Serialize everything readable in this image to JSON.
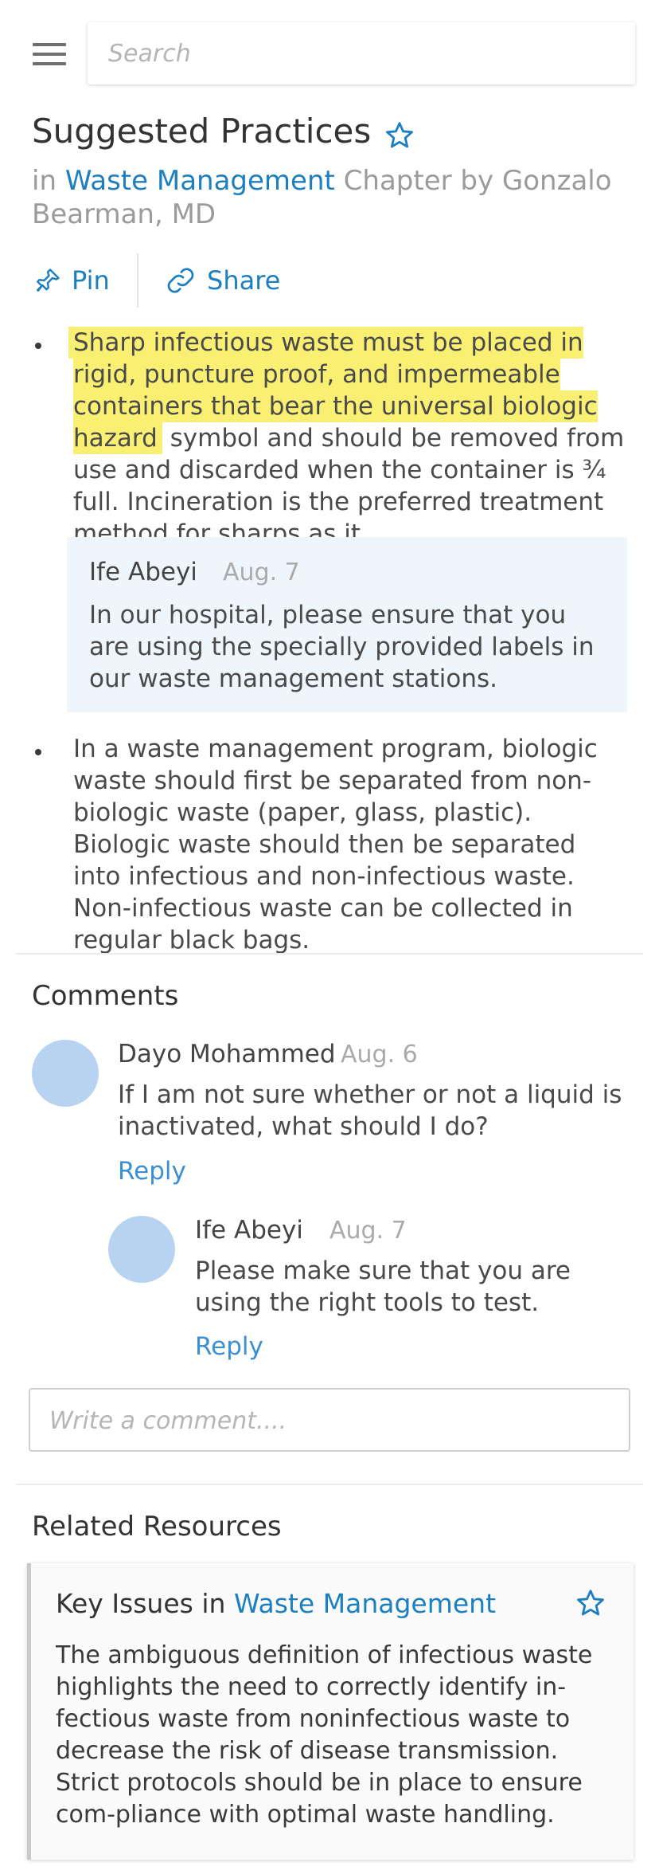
{
  "search": {
    "placeholder": "Search"
  },
  "article": {
    "title": "Suggested Practices",
    "in_prefix": "in",
    "chapter_link": "Waste Management",
    "chapter_suffix": "Chapter by Gonzalo Bearman, MD"
  },
  "actions": {
    "pin_label": "Pin",
    "share_label": "Share"
  },
  "bullets": [
    {
      "highlighted": "Sharp infectious waste must be placed in rigid, puncture proof, and impermeable containers that bear the universal biologic hazard",
      "rest": "symbol and should be removed from use and discarded when the container is ¾ full. Incineration is the preferred treatment method for sharps as it"
    },
    {
      "text": "In a waste management program, biologic waste should first be separated from non-biologic waste (paper, glass, plastic). Biologic waste should then be separated into infectious and non-infectious waste. Non-infectious waste can be collected in regular black bags."
    }
  ],
  "note": {
    "author": "Ife Abeyi",
    "date": "Aug. 7",
    "text": "In our hospital, please ensure that you are using the specially provided labels in our waste management stations."
  },
  "comments": {
    "title": "Comments",
    "items": [
      {
        "author": "Dayo Mohammed",
        "date": "Aug. 6",
        "text": "If I am not sure whether or not a liquid is inactivated, what should I do?",
        "reply_label": "Reply"
      },
      {
        "author": "Ife Abeyi",
        "date": "Aug. 7",
        "text": "Please make sure that you are using the right tools to test.",
        "reply_label": "Reply"
      }
    ],
    "input_placeholder": "Write a comment...."
  },
  "related": {
    "title": "Related Resources",
    "card": {
      "title": "Key Issues",
      "in_prefix": "in",
      "link": "Waste Management",
      "text": "The ambiguous definition of infectious waste highlights the need to correctly identify in-fectious waste from noninfectious waste to decrease the risk of disease transmission. Strict protocols should be in place to ensure com-pliance with optimal waste handling."
    }
  },
  "colors": {
    "accent": "#1c7fbf",
    "highlight": "#f8ef73",
    "note_bg": "#eef6fb",
    "avatar": "#b8d3f2"
  },
  "icons": [
    "menu-icon",
    "star-outline-icon",
    "pin-icon",
    "link-icon"
  ]
}
